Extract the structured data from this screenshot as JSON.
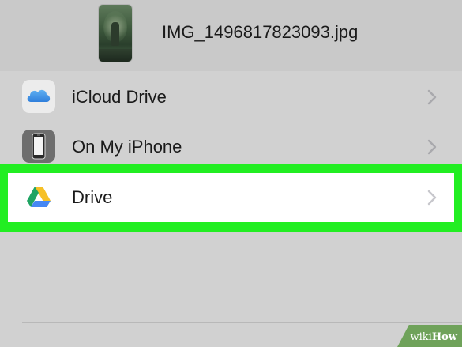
{
  "header": {
    "filename": "IMG_1496817823093.jpg",
    "thumbnail_icon": "photo-thumbnail"
  },
  "locations": [
    {
      "label": "iCloud Drive",
      "icon": "icloud-icon",
      "chevron": "chevron-right-icon"
    },
    {
      "label": "On My iPhone",
      "icon": "iphone-icon",
      "chevron": "chevron-right-icon"
    },
    {
      "label": "Drive",
      "icon": "google-drive-icon",
      "chevron": "chevron-right-icon",
      "highlighted": true
    }
  ],
  "colors": {
    "background": "#d1d1d1",
    "highlight": "#22ee22",
    "chevron": "#c7c7cc",
    "icloud_blue": "#3d8ee6"
  },
  "watermark": {
    "prefix": "wiki",
    "suffix": "How"
  }
}
